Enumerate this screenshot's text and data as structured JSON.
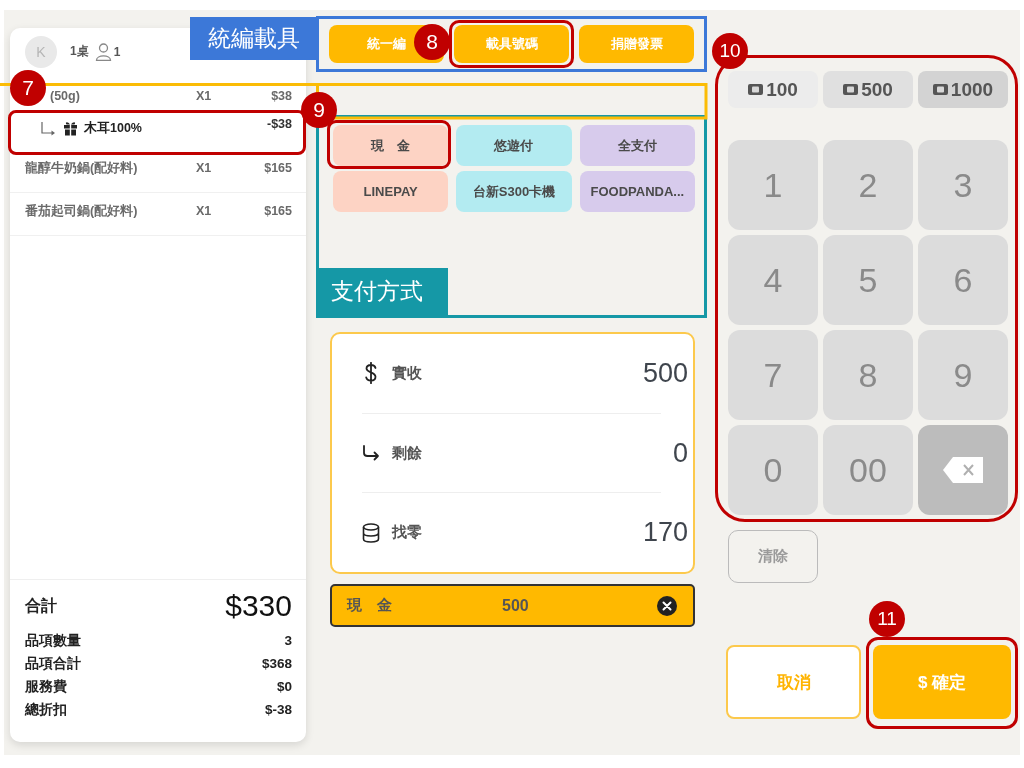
{
  "order": {
    "avatar": "K",
    "table": "1桌",
    "guests": "1",
    "items": [
      {
        "kind": "item",
        "name": "(50g)",
        "qty": "X1",
        "price": "$38"
      },
      {
        "kind": "discount",
        "name": "木耳100%",
        "price": "-$38",
        "callout": "7"
      },
      {
        "kind": "item",
        "name": "龍醇牛奶鍋(配好料)",
        "qty": "X1",
        "price": "$165"
      },
      {
        "kind": "item",
        "name": "番茄起司鍋(配好料)",
        "qty": "X1",
        "price": "$165"
      }
    ],
    "total": {
      "label": "合計",
      "value": "$330"
    },
    "summary": [
      {
        "label": "品項數量",
        "value": "3"
      },
      {
        "label": "品項合計",
        "value": "$368"
      },
      {
        "label": "服務費",
        "value": "$0"
      },
      {
        "label": "總折扣",
        "value": "$-38"
      }
    ]
  },
  "invoice": {
    "annotation": "統編載具",
    "buttons": [
      {
        "label": "統一編"
      },
      {
        "label": "載具號碼",
        "callout": "8"
      },
      {
        "label": "捐贈發票"
      }
    ]
  },
  "payment_methods": {
    "annotation": "支付方式",
    "items": [
      {
        "label": "現　金",
        "color": "#fdd3c4",
        "callout": "9"
      },
      {
        "label": "悠遊付",
        "color": "#b3ebf1"
      },
      {
        "label": "全支付",
        "color": "#d7cbec"
      },
      {
        "label": "LINEPAY",
        "color": "#fdd3c4"
      },
      {
        "label": "台新S300卡機",
        "color": "#b3ebf1"
      },
      {
        "label": "FOODPANDA...",
        "color": "#d7cbec"
      }
    ]
  },
  "tender": [
    {
      "kind": "received",
      "label": "實收",
      "value": "500"
    },
    {
      "kind": "remaining",
      "label": "剩餘",
      "value": "0"
    },
    {
      "kind": "change",
      "label": "找零",
      "value": "170"
    }
  ],
  "payments": [
    {
      "method": "現　金",
      "amount": "500"
    }
  ],
  "keypad": {
    "callout": "10",
    "quick_amounts": [
      {
        "label": "100"
      },
      {
        "label": "500"
      },
      {
        "label": "1000"
      }
    ],
    "keys": [
      {
        "kind": "digit",
        "label": "1"
      },
      {
        "kind": "digit",
        "label": "2"
      },
      {
        "kind": "digit",
        "label": "3"
      },
      {
        "kind": "digit",
        "label": "4"
      },
      {
        "kind": "digit",
        "label": "5"
      },
      {
        "kind": "digit",
        "label": "6"
      },
      {
        "kind": "digit",
        "label": "7"
      },
      {
        "kind": "digit",
        "label": "8"
      },
      {
        "kind": "digit",
        "label": "9"
      },
      {
        "kind": "digit",
        "label": "0"
      },
      {
        "kind": "digit",
        "label": "00"
      },
      {
        "kind": "backspace"
      }
    ]
  },
  "clear_button": "清除",
  "actions": [
    {
      "kind": "cancel",
      "label": "取消"
    },
    {
      "kind": "confirm",
      "label": "$ 確定",
      "callout": "11"
    }
  ]
}
